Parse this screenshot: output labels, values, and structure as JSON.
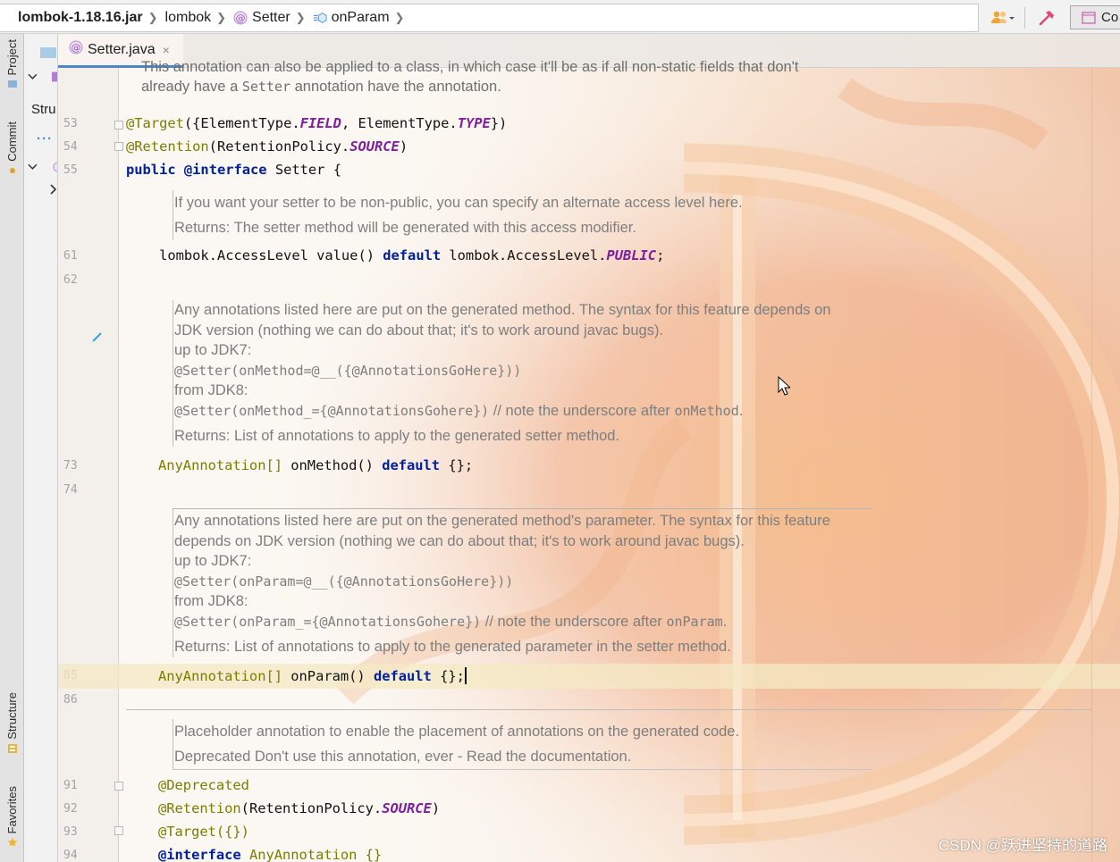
{
  "breadcrumb": {
    "items": [
      {
        "label": "lombok-1.18.16.jar",
        "icon": "none"
      },
      {
        "label": "lombok",
        "icon": "none"
      },
      {
        "label": "Setter",
        "icon": "annotation-icon"
      },
      {
        "label": "onParam",
        "icon": "method-icon"
      }
    ],
    "separator": "❯"
  },
  "toolbar": {
    "icons": [
      "users-icon",
      "dropdown-arrow-icon",
      "build-hammer-icon"
    ],
    "run_config_label": "Co"
  },
  "left_strip": {
    "tabs": [
      "Project",
      "Commit",
      "Structure",
      "Favorites"
    ]
  },
  "project_panel": {
    "stru_label": "Stru"
  },
  "editor": {
    "tab_label": "Setter.java",
    "tab_close": "×",
    "colors": {
      "accent": "#4a86c8",
      "keyword": "#00219b",
      "annotation": "#7b7c00",
      "constant": "#7f1f9e",
      "doc": "#7e7e7e"
    },
    "line_numbers": [
      "53",
      "54",
      "55",
      "61",
      "62",
      "73",
      "74",
      "85",
      "86",
      "91",
      "92",
      "93",
      "94"
    ],
    "doc_top": {
      "line1": "This annotation can also be applied to a class, in which case it'll be as if all non-static fields that don't",
      "line2a": "already have a ",
      "line2_code": "Setter",
      "line2b": " annotation have the annotation."
    },
    "code": {
      "l53_ann": "@Target",
      "l53_rest_a": "({ElementType.",
      "l53_c1": "FIELD",
      "l53_rest_b": ", ElementType.",
      "l53_c2": "TYPE",
      "l53_rest_c": "})",
      "l54_ann": "@Retention",
      "l54_rest_a": "(RetentionPolicy.",
      "l54_c1": "SOURCE",
      "l54_rest_b": ")",
      "l55_kw1": "public",
      "l55_kw2": "@interface",
      "l55_rest": " Setter {",
      "l61_a": "    lombok.AccessLevel value() ",
      "l61_kw": "default",
      "l61_b": " lombok.AccessLevel.",
      "l61_c": "PUBLIC",
      "l61_d": ";",
      "l73_typ": "AnyAnnotation[]",
      "l73_a": " onMethod() ",
      "l73_kw": "default",
      "l73_b": " {};",
      "l85_typ": "AnyAnnotation[]",
      "l85_a": " onParam() ",
      "l85_kw": "default",
      "l85_b": " {};",
      "l91": "@Deprecated",
      "l92_ann": "@Retention",
      "l92_a": "(RetentionPolicy.",
      "l92_c": "SOURCE",
      "l92_b": ")",
      "l93": "@Target({})",
      "l94_kw": "@interface",
      "l94_rest": " AnyAnnotation {}"
    },
    "doc_value": {
      "line1": "If you want your setter to be non-public, you can specify an alternate access level here.",
      "line2": "Returns: The setter method will be generated with this access modifier."
    },
    "doc_onmethod": {
      "line1": "Any annotations listed here are put on the generated method. The syntax for this feature depends on",
      "line2": "JDK version (nothing we can do about that; it's to work around javac bugs).",
      "line3": "up to JDK7:",
      "line4": "@Setter(onMethod=@__({@AnnotationsGoHere}))",
      "line5": "from JDK8:",
      "line6_code": "@Setter(onMethod_={@AnnotationsGohere})",
      "line6_text": " // note the underscore after ",
      "line6_code2": "onMethod",
      "line6_end": ".",
      "line7": "Returns: List of annotations to apply to the generated setter method."
    },
    "doc_onparam": {
      "line1": "Any annotations listed here are put on the generated method's parameter. The syntax for this feature",
      "line2": "depends on JDK version (nothing we can do about that; it's to work around javac bugs).",
      "line3": "up to JDK7:",
      "line4": "@Setter(onParam=@__({@AnnotationsGoHere}))",
      "line5": "from JDK8:",
      "line6_code": "@Setter(onParam_={@AnnotationsGohere})",
      "line6_text": " // note the underscore after ",
      "line6_code2": "onParam",
      "line6_end": ".",
      "line7": "Returns: List of annotations to apply to the generated parameter in the setter method."
    },
    "doc_anyannotation": {
      "line1": "Placeholder annotation to enable the placement of annotations on the generated code.",
      "line2": "Deprecated Don't use this annotation, ever - Read the documentation."
    }
  },
  "watermark": "CSDN @跃进坚持的道路"
}
